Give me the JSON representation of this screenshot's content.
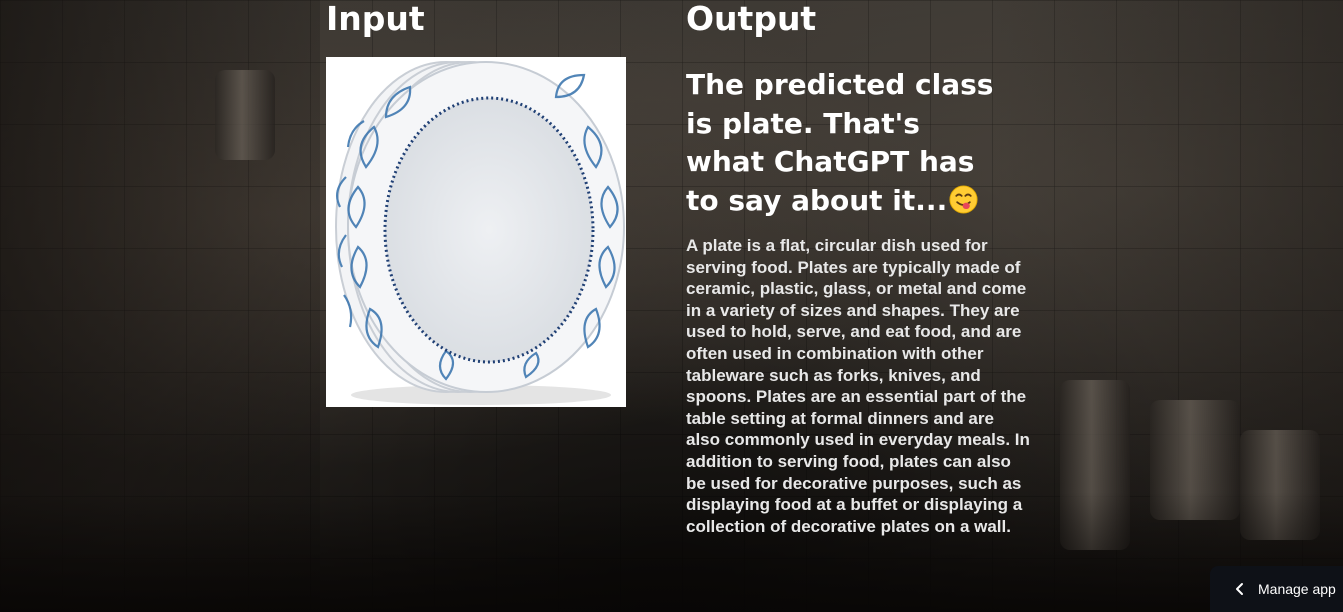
{
  "input_section": {
    "title": "Input",
    "image_icon": "plates-photo"
  },
  "output_section": {
    "title": "Output",
    "prediction_text": "The predicted class is plate. That's what ChatGPT has to say about it...",
    "prediction_emoji_icon": "face-savoring-food-emoji",
    "description": "A plate is a flat, circular dish used for serving food. Plates are typically made of ceramic, plastic, glass, or metal and come in a variety of sizes and shapes. They are used to hold, serve, and eat food, and are often used in combination with other tableware such as forks, knives, and spoons. Plates are an essential part of the table setting at formal dinners and are also commonly used in everyday meals. In addition to serving food, plates can also be used for decorative purposes, such as displaying food at a buffet or displaying a collection of decorative plates on a wall."
  },
  "footer": {
    "manage_app_label": "Manage app",
    "manage_app_icon": "chevron-left-icon"
  },
  "colors": {
    "text": "#ffffff",
    "manage_bar": "#0e1117",
    "plate_pattern": "#3f78b0"
  }
}
